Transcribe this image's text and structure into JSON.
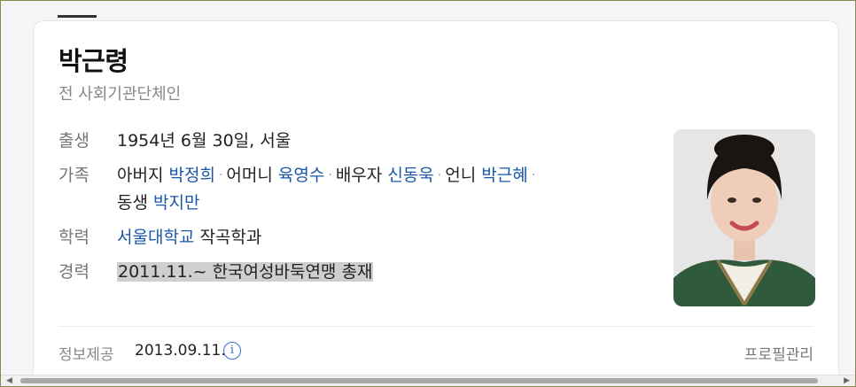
{
  "profile": {
    "name": "박근령",
    "description": "전 사회기관단체인"
  },
  "info": {
    "birth": {
      "label": "출생",
      "value": "1954년 6월 30일, 서울"
    },
    "family": {
      "label": "가족",
      "father_rel": "아버지",
      "father": "박정희",
      "mother_rel": "어머니",
      "mother": "육영수",
      "spouse_rel": "배우자",
      "spouse": "신동욱",
      "sister_rel": "언니",
      "sister": "박근혜",
      "brother_rel": "동생",
      "brother": "박지만"
    },
    "education": {
      "label": "학력",
      "school": "서울대학교",
      "major": "작곡학과"
    },
    "career": {
      "label": "경력",
      "value": "2011.11.~ 한국여성바둑연맹 총재"
    }
  },
  "footer": {
    "source_label": "정보제공",
    "date": "2013.09.11.",
    "manage_label": "프로필관리"
  },
  "icons": {
    "info": "info-icon",
    "scroll_left": "arrow-left-icon",
    "scroll_right": "arrow-right-icon"
  },
  "colors": {
    "link": "#1a57a8",
    "highlight": "#cfcfcf",
    "info_icon": "#3b6fd1"
  }
}
